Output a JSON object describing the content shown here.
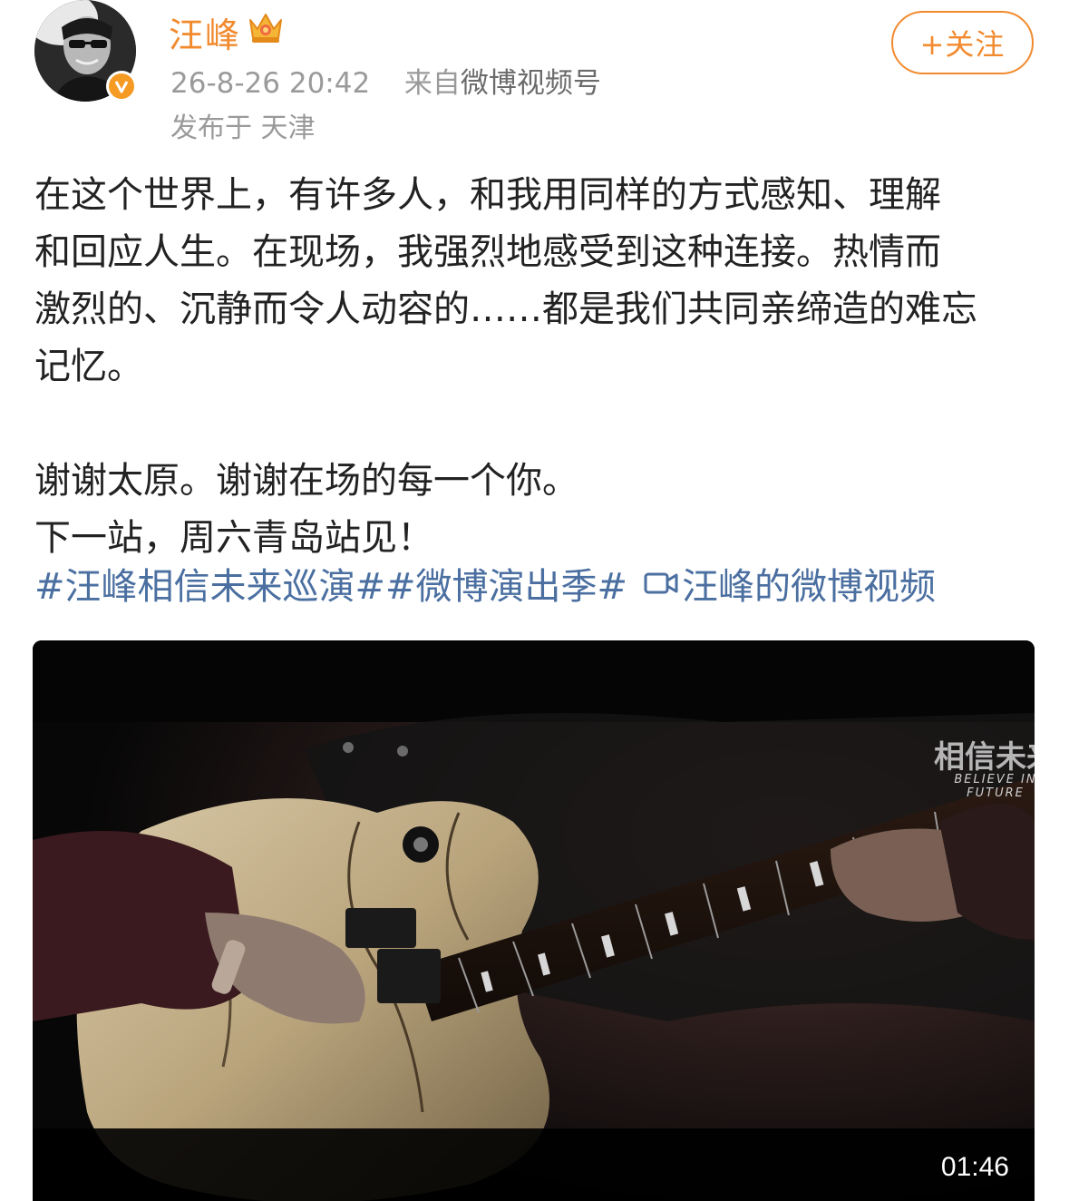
{
  "header": {
    "username": "汪峰",
    "timestamp": "26-8-26 20:42",
    "source_prefix": "来自",
    "source": "微博视频号",
    "location": "发布于 天津",
    "follow_label": "+关注",
    "accent_color": "#f28a2e"
  },
  "post": {
    "lines": [
      "在这个世界上，有许多人，和我用同样的方式感知、理解",
      "和回应人生。在现场，我强烈地感受到这种连接。热情而",
      "激烈的、沉静而令人动容的……都是我们共同亲缔造的难忘",
      "记忆。",
      "谢谢太原。谢谢在场的每一个你。",
      "下一站，周六青岛站见！"
    ],
    "tags": [
      "#汪峰相信未来巡演#",
      "#微博演出季#"
    ],
    "video_link": "汪峰的微博视频",
    "link_color": "#4a6fa0"
  },
  "video": {
    "watermark_cn": "相信未来",
    "watermark_en": "BELIEVE IN FUTURE",
    "duration": "01:46"
  }
}
